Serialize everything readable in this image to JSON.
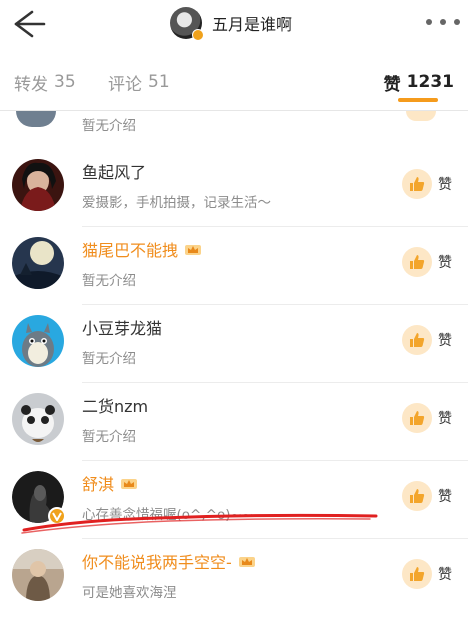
{
  "header": {
    "title": "五月是谁啊",
    "back_icon": "back-arrow-icon",
    "more_icon": "more-dots-icon"
  },
  "tabs": {
    "forward": {
      "label": "转发",
      "count": "35"
    },
    "comment": {
      "label": "评论",
      "count": "51"
    },
    "like": {
      "label": "赞",
      "count": "1231"
    }
  },
  "partial_row": {
    "desc": "暂无介绍"
  },
  "rows": [
    {
      "name": "鱼起风了",
      "desc": "爱摄影，手机拍摄，记录生活～",
      "vip": false,
      "like_label": "赞"
    },
    {
      "name": "猫尾巴不能拽",
      "desc": "暂无介绍",
      "vip": true,
      "like_label": "赞"
    },
    {
      "name": "小豆芽龙猫",
      "desc": "暂无介绍",
      "vip": false,
      "like_label": "赞"
    },
    {
      "name": "二货nzm",
      "desc": "暂无介绍",
      "vip": false,
      "like_label": "赞"
    },
    {
      "name": "舒淇",
      "desc": "心存善念惜福喔(o^,^o)~~",
      "vip": true,
      "verified": true,
      "like_label": "赞"
    },
    {
      "name": "你不能说我两手空空-",
      "desc": "可是她喜欢海涅",
      "vip": true,
      "like_label": "赞"
    }
  ],
  "colors": {
    "accent": "#f59b1c",
    "vip_name": "#f08d1d",
    "annotation": "#e02020"
  }
}
